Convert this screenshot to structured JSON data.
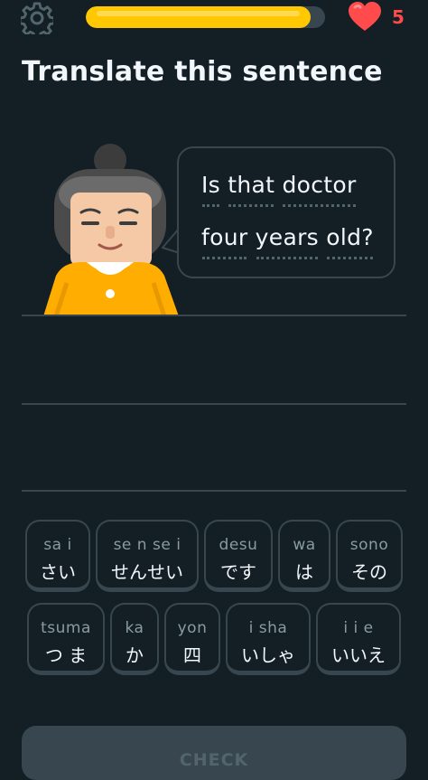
{
  "header": {
    "settings_icon": "gear-icon",
    "progress_fraction": 0.94,
    "hearts_icon": "heart-icon",
    "hearts_count": "5"
  },
  "title": "Translate this sentence",
  "bubble": {
    "line1": [
      "Is",
      "that",
      "doctor"
    ],
    "line2": [
      "four",
      "years",
      "old?"
    ]
  },
  "word_bank": [
    [
      {
        "romaji": "sa i",
        "kana": "さい"
      },
      {
        "romaji": "se n se i",
        "kana": "せんせい"
      },
      {
        "romaji": "desu",
        "kana": "です"
      },
      {
        "romaji": "wa",
        "kana": "は"
      },
      {
        "romaji": "sono",
        "kana": "その"
      }
    ],
    [
      {
        "romaji": "tsuma",
        "kana": "つ ま"
      },
      {
        "romaji": "ka",
        "kana": "か"
      },
      {
        "romaji": "yon",
        "kana": "四"
      },
      {
        "romaji": "i sha",
        "kana": "いしゃ"
      },
      {
        "romaji": "i i e",
        "kana": "いいえ"
      }
    ]
  ],
  "check_label": "CHECK",
  "colors": {
    "background": "#131f24",
    "progress": "#ffc800",
    "heart": "#ff4b4b",
    "border": "#37464f",
    "character_shirt": "#ffad00"
  }
}
